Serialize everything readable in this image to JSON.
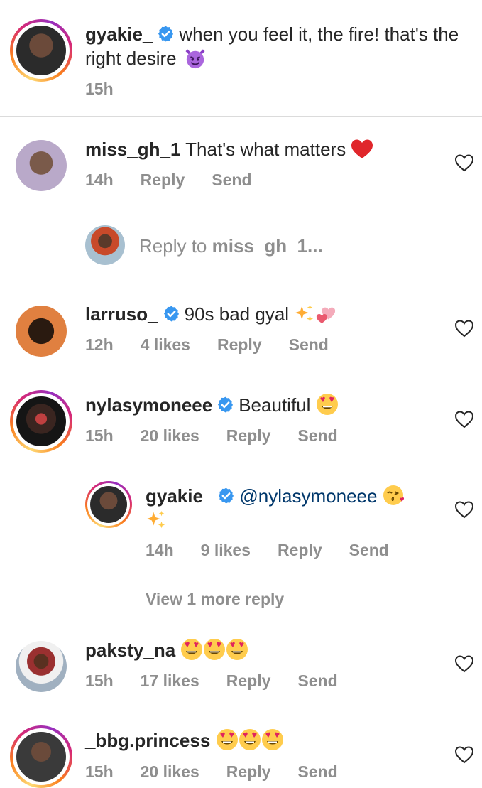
{
  "caption": {
    "username": "gyakie_",
    "text": "when you feel it, the fire! that's the right desire",
    "time": "15h"
  },
  "comments": [
    {
      "username": "miss_gh_1",
      "text": "That's what matters",
      "time": "14h",
      "likes": "",
      "reply": "Reply",
      "send": "Send"
    },
    {
      "username": "larruso_",
      "text": "90s bad gyal",
      "time": "12h",
      "likes": "4 likes",
      "reply": "Reply",
      "send": "Send"
    },
    {
      "username": "nylasymoneee",
      "text": "Beautiful",
      "time": "15h",
      "likes": "20 likes",
      "reply": "Reply",
      "send": "Send"
    },
    {
      "username": "gyakie_",
      "text": "@nylasymoneee",
      "time": "14h",
      "likes": "9 likes",
      "reply": "Reply",
      "send": "Send"
    },
    {
      "username": "paksty_na",
      "text": "",
      "time": "15h",
      "likes": "17 likes",
      "reply": "Reply",
      "send": "Send"
    },
    {
      "username": "_bbg.princess",
      "text": "",
      "time": "15h",
      "likes": "20 likes",
      "reply": "Reply",
      "send": "Send"
    }
  ],
  "reply_prompt": {
    "prefix": "Reply to ",
    "target": "miss_gh_1..."
  },
  "view_more": "View 1 more reply",
  "colors": {
    "text": "#262626",
    "meta": "#8e8e8e",
    "verified": "#3897f0",
    "mention": "#00376b",
    "divider": "#dbdbdb"
  },
  "icons": [
    "verified-badge-icon",
    "heart-icon",
    "smiling-imp-emoji",
    "red-heart-emoji",
    "sparkles-emoji",
    "two-hearts-emoji",
    "heart-eyes-emoji",
    "kissing-heart-emoji"
  ]
}
